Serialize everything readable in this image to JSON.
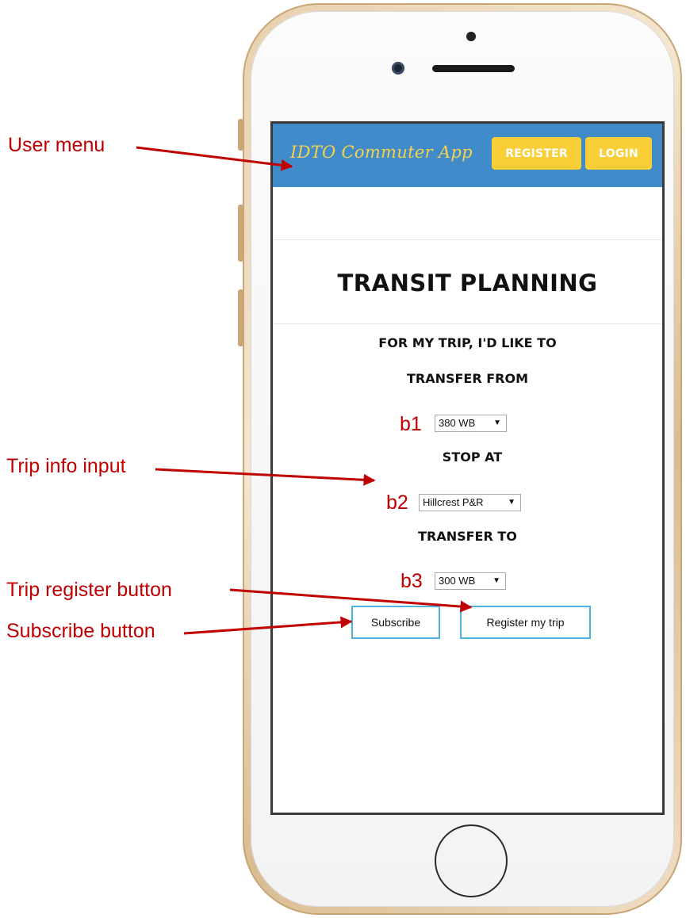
{
  "app": {
    "title": "IDTO Commuter App",
    "register_label": "REGISTER",
    "login_label": "LOGIN"
  },
  "page": {
    "title": "TRANSIT PLANNING",
    "intro": "FOR MY TRIP, I'D LIKE TO",
    "transfer_from_label": "TRANSFER FROM",
    "stop_at_label": "STOP AT",
    "transfer_to_label": "TRANSFER TO"
  },
  "form": {
    "b1": {
      "tag": "b1",
      "value": "380 WB"
    },
    "b2": {
      "tag": "b2",
      "value": "Hillcrest P&R"
    },
    "b3": {
      "tag": "b3",
      "value": "300 WB"
    },
    "subscribe_label": "Subscribe",
    "register_trip_label": "Register my trip"
  },
  "annotations": {
    "user_menu": "User menu",
    "trip_info_input": "Trip info input",
    "trip_register_button": "Trip register button",
    "subscribe_button": "Subscribe button"
  },
  "colors": {
    "header": "#428bca",
    "nav_button": "#f9ce36",
    "app_title": "#f6d24a",
    "annotation": "#c00000",
    "button_border": "#4eb3e0"
  },
  "icons": {
    "dropdown": "chevron-down-icon"
  }
}
